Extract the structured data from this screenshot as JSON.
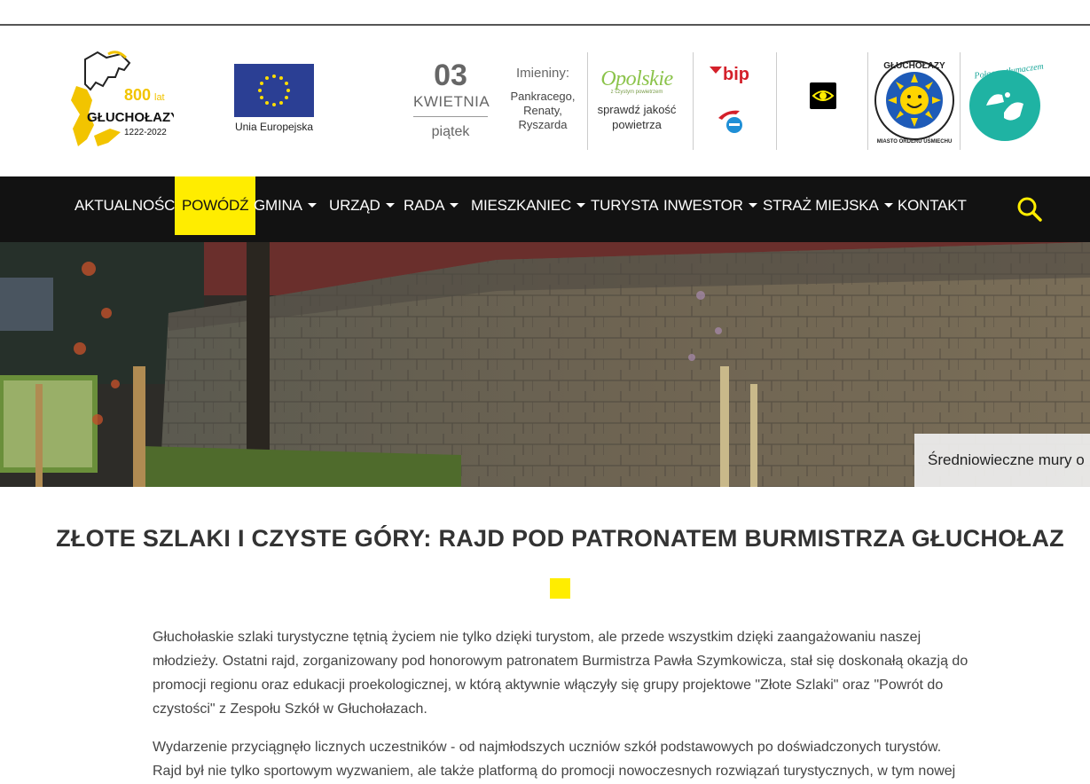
{
  "header": {
    "logo800": {
      "number": "800",
      "suffix": "lat",
      "name": "GŁUCHOŁAZY",
      "years": "1222-2022"
    },
    "eu_label": "Unia Europejska",
    "date": {
      "day": "03",
      "month": "KWIETNIA",
      "weekday": "piątek"
    },
    "names": {
      "label": "Imieniny:",
      "list": "Pankracego, Renaty, Ryszarda"
    },
    "air": {
      "brand": "Opolskie",
      "tagline": "z czystym powietrzem",
      "text": "sprawdź jakość powietrza"
    },
    "bip": "bip",
    "medal": {
      "top": "GŁUCHOŁAZY",
      "bottom": "MIASTO ORDERU UŚMIECHU"
    },
    "translator": "Połącz z tłumaczem"
  },
  "nav": {
    "items": [
      {
        "label": "AKTUALNOŚCI",
        "dropdown": false
      },
      {
        "label": "POWÓDŹ",
        "dropdown": false,
        "active": true
      },
      {
        "label": "GMINA",
        "dropdown": true
      },
      {
        "label": "URZĄD",
        "dropdown": true
      },
      {
        "label": "RADA",
        "dropdown": true
      },
      {
        "label": "MIESZKANIEC",
        "dropdown": true
      },
      {
        "label": "TURYSTA",
        "dropdown": false
      },
      {
        "label": "INWESTOR",
        "dropdown": true
      },
      {
        "label": "STRAŻ MIEJSKA",
        "dropdown": true
      },
      {
        "label": "KONTAKT",
        "dropdown": false
      }
    ]
  },
  "hero": {
    "caption": "Średniowieczne mury o"
  },
  "article": {
    "title": "ZŁOTE SZLAKI I CZYSTE GÓRY: RAJD POD PATRONATEM BURMISTRZA GŁUCHOŁAZ",
    "paragraphs": [
      "Głuchołaskie szlaki turystyczne tętnią życiem nie tylko dzięki turystom, ale przede wszystkim dzięki zaangażowaniu naszej młodzieży. Ostatni rajd, zorganizowany pod honorowym patronatem Burmistrza Pawła Szymkowicza, stał się doskonałą okazją do promocji regionu oraz edukacji proekologicznej, w którą aktywnie włączyły  się grupy projektowe \"Złote Szlaki\" oraz \"Powrót do czystości\" z Zespołu Szkół w Głuchołazach.",
      "Wydarzenie przyciągnęło licznych uczestników - od najmłodszych uczniów szkół podstawowych po doświadczonych turystów. Rajd był nie tylko sportowym wyzwaniem, ale także platformą do promocji nowoczesnych rozwiązań turystycznych, w tym nowej"
    ]
  },
  "colors": {
    "accent": "#ffed00",
    "nav_bg": "#121212"
  }
}
